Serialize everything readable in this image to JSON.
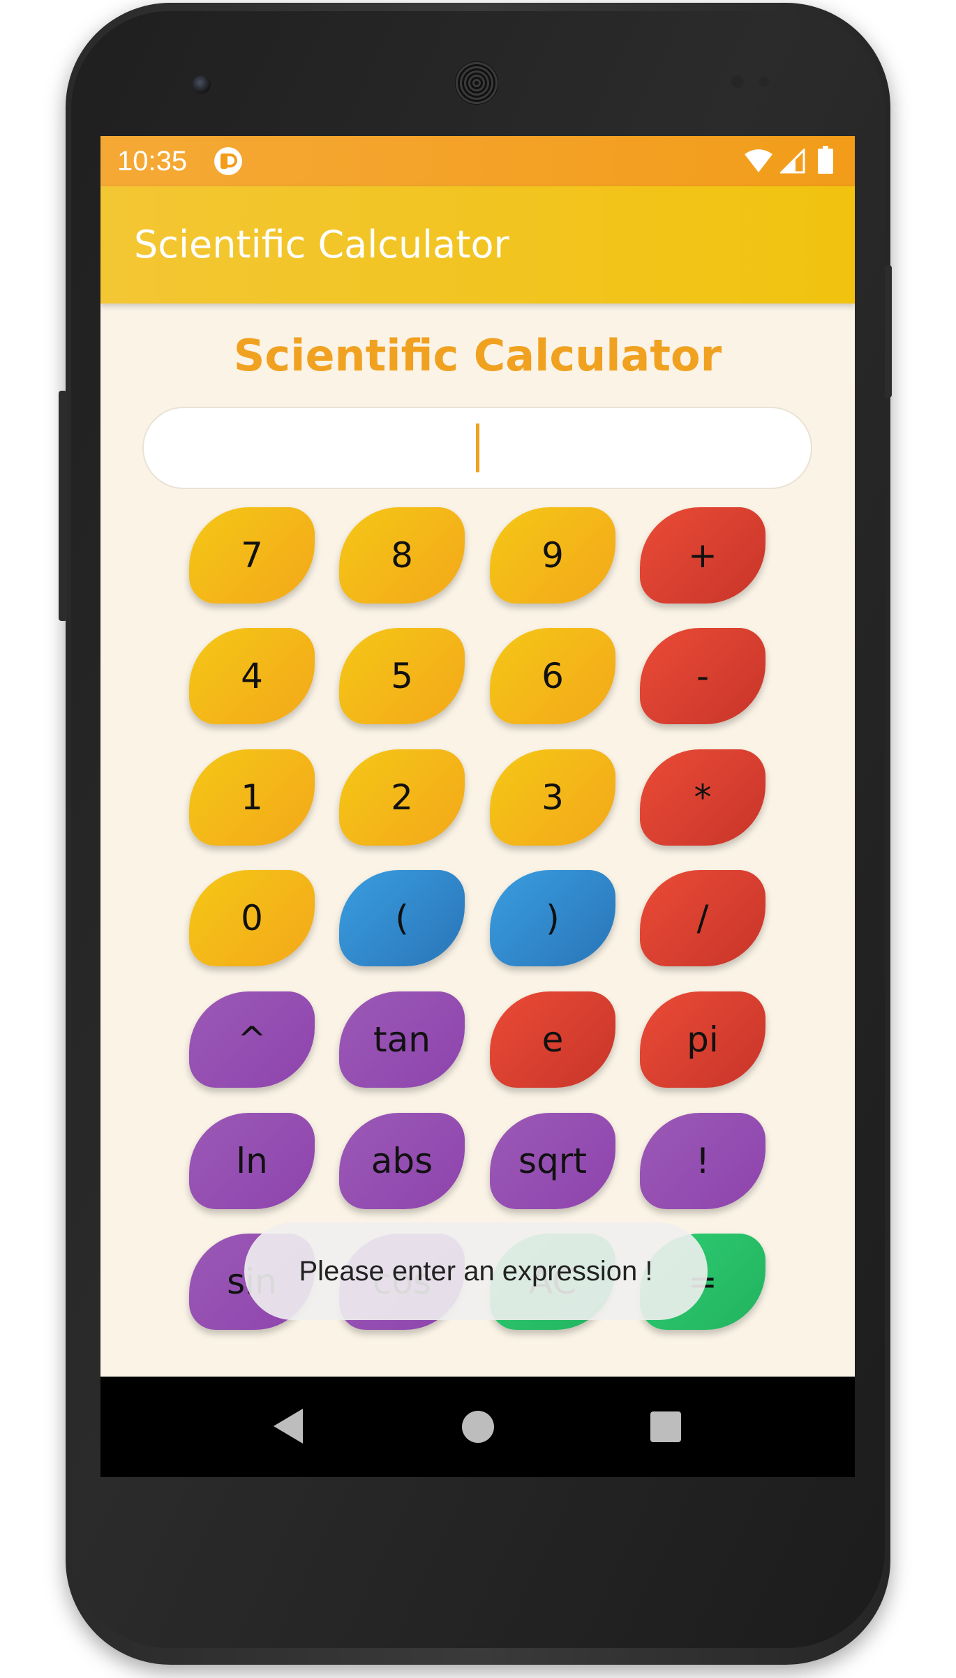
{
  "status_bar": {
    "time": "10:35",
    "icons": [
      "app-notification-icon",
      "wifi-icon",
      "signal-icon",
      "battery-icon"
    ]
  },
  "app_bar": {
    "title": "Scientific Calculator",
    "color": "#f1c30f"
  },
  "heading": "Scientific Calculator",
  "expression_input": {
    "value": "",
    "placeholder": ""
  },
  "keypad": {
    "rows": [
      [
        {
          "label": "7",
          "color": "yellow"
        },
        {
          "label": "8",
          "color": "yellow"
        },
        {
          "label": "9",
          "color": "yellow"
        },
        {
          "label": "+",
          "color": "red"
        }
      ],
      [
        {
          "label": "4",
          "color": "yellow"
        },
        {
          "label": "5",
          "color": "yellow"
        },
        {
          "label": "6",
          "color": "yellow"
        },
        {
          "label": "-",
          "color": "red"
        }
      ],
      [
        {
          "label": "1",
          "color": "yellow"
        },
        {
          "label": "2",
          "color": "yellow"
        },
        {
          "label": "3",
          "color": "yellow"
        },
        {
          "label": "*",
          "color": "red"
        }
      ],
      [
        {
          "label": "0",
          "color": "yellow"
        },
        {
          "label": "(",
          "color": "blue"
        },
        {
          "label": ")",
          "color": "blue"
        },
        {
          "label": "/",
          "color": "red"
        }
      ],
      [
        {
          "label": "^",
          "color": "purple"
        },
        {
          "label": "tan",
          "color": "purple"
        },
        {
          "label": "e",
          "color": "red"
        },
        {
          "label": "pi",
          "color": "red"
        }
      ],
      [
        {
          "label": "ln",
          "color": "purple"
        },
        {
          "label": "abs",
          "color": "purple"
        },
        {
          "label": "sqrt",
          "color": "purple"
        },
        {
          "label": "!",
          "color": "purple"
        }
      ],
      [
        {
          "label": "sin",
          "color": "purple"
        },
        {
          "label": "cos",
          "color": "purple"
        },
        {
          "label": "AC",
          "color": "green"
        },
        {
          "label": "=",
          "color": "green"
        }
      ]
    ]
  },
  "toast": {
    "message": "Please enter an expression !"
  },
  "nav_bar": {
    "buttons": [
      "back-icon",
      "home-icon",
      "recents-icon"
    ]
  },
  "colors": {
    "accent": "#f0a120",
    "status_bar": "#f29c1a",
    "background": "#faf3e6"
  }
}
